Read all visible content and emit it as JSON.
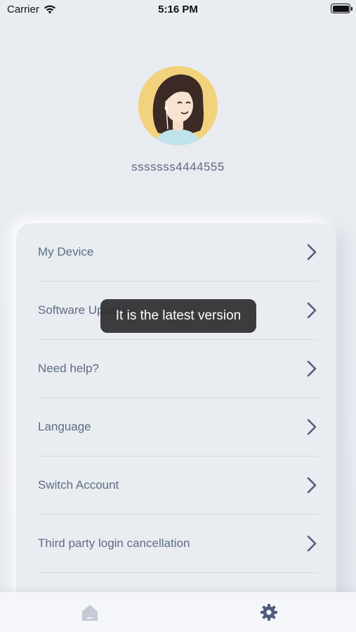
{
  "status_bar": {
    "carrier": "Carrier",
    "time": "5:16 PM"
  },
  "profile": {
    "username": "sssssss4444555",
    "avatar_bg": "#f2d27c"
  },
  "menu": {
    "items": [
      {
        "label": "My Device"
      },
      {
        "label": "Software Update"
      },
      {
        "label": "Need help?"
      },
      {
        "label": "Language"
      },
      {
        "label": "Switch Account"
      },
      {
        "label": "Third party login cancellation"
      }
    ]
  },
  "toast": {
    "message": "It is the latest version"
  },
  "tab_bar": {
    "tabs": [
      {
        "icon": "home-icon",
        "active": false
      },
      {
        "icon": "gear-icon",
        "active": true
      }
    ],
    "active_color": "#4f5b7c",
    "inactive_color": "#c4cad6"
  }
}
